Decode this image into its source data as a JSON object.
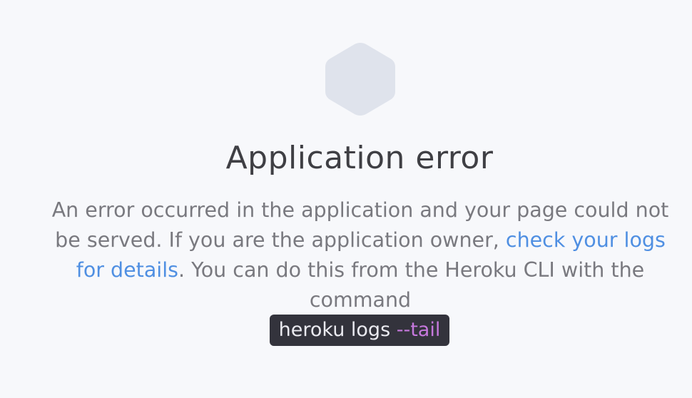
{
  "error": {
    "title": "Application error",
    "message_part1": "An error occurred in the application and your page could not be served. If you are the application owner, ",
    "link_text": "check your logs for details",
    "message_part2": ". You can do this from the Heroku CLI with the command",
    "command_base": "heroku logs ",
    "command_flag": "--tail"
  },
  "colors": {
    "background": "#f7f8fb",
    "hexagon": "#dfe3ec",
    "title": "#3f3f44",
    "body_text": "#79797f",
    "link": "#4f8fe2",
    "code_bg": "#33333c",
    "code_flag": "#c678dd"
  },
  "icons": {
    "logo": "hexagon-icon"
  }
}
